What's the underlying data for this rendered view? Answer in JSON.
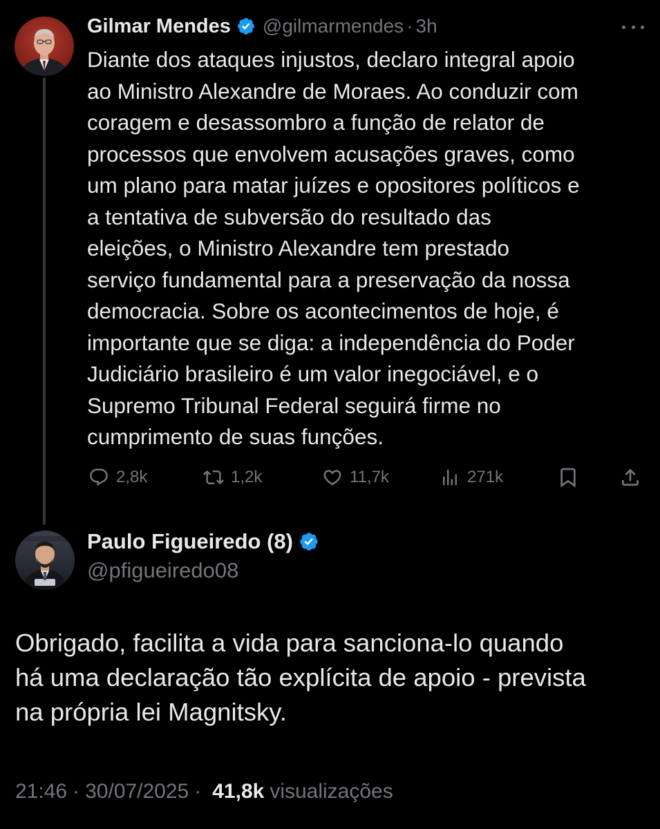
{
  "tweet": {
    "author_name": "Gilmar Mendes",
    "handle": "@gilmarmendes",
    "separator": "·",
    "time_ago": "3h",
    "lines": [
      "Diante dos ataques injustos, declaro integral apoio",
      "ao Ministro Alexandre de Moraes. Ao conduzir com",
      "coragem e desassombro a função de relator de",
      "processos que envolvem acusações graves, como",
      "um plano para matar juízes e opositores políticos e",
      "a tentativa de subversão do resultado das",
      "eleições, o Ministro Alexandre tem prestado",
      "serviço fundamental para a preservação da nossa",
      "democracia. Sobre os acontecimentos de hoje, é",
      "importante que se diga: a independência do Poder",
      "Judiciário brasileiro é um valor inegociável, e o",
      "Supremo Tribunal Federal seguirá firme no",
      "cumprimento de suas funções."
    ],
    "stats": {
      "replies": "2,8k",
      "retweets": "1,2k",
      "likes": "11,7k",
      "views": "271k"
    }
  },
  "reply": {
    "author_name": "Paulo Figueiredo (8)",
    "handle": "@pfigueiredo08",
    "lines": [
      "Obrigado, facilita a vida para sanciona-lo quando",
      "há uma declaração tão explícita de apoio - prevista",
      "na própria lei Magnitsky."
    ],
    "meta": {
      "time": "21:46",
      "separator": "·",
      "date": "30/07/2025",
      "views_count": "41,8k",
      "views_label": "visualizações"
    }
  },
  "colors": {
    "background": "#000000",
    "text": "#e7e9ea",
    "secondary": "#71767b",
    "verified": "#1d9bf0",
    "thread_line": "#333639"
  },
  "icons": [
    "verified-badge-icon",
    "more-icon",
    "reply-icon",
    "retweet-icon",
    "like-icon",
    "views-icon",
    "bookmark-icon",
    "share-icon"
  ]
}
